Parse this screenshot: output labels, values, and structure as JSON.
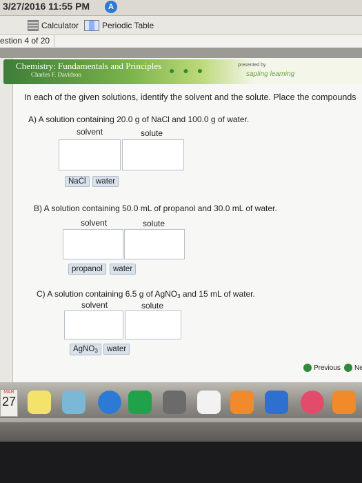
{
  "status": {
    "datetime": "3/27/2016 11:55 PM",
    "badge": "A"
  },
  "tools": {
    "calculator": "Calculator",
    "periodic_table": "Periodic Table"
  },
  "counter": "estion 4 of 20",
  "banner": {
    "title": "Chemistry: Fundamentals and Principles",
    "author": "Charles F. Davidson",
    "presented_by": "presented by",
    "brand": "sapling learning"
  },
  "instructions": "In each of the given solutions, identify the solvent and the solute. Place the compounds",
  "questions": [
    {
      "text": "A) A solution containing 20.0 g of NaCl and 100.0 g of water.",
      "solvent_label": "solvent",
      "solute_label": "solute",
      "chips": [
        "NaCl",
        "water"
      ]
    },
    {
      "text": "B) A solution containing 50.0 mL of propanol and 30.0 mL of water.",
      "solvent_label": "solvent",
      "solute_label": "solute",
      "chips": [
        "propanol",
        "water"
      ]
    },
    {
      "text_pre": "C) A solution containing 6.5 g of AgNO",
      "text_sub": "3",
      "text_post": " and 15 mL of water.",
      "solvent_label": "solvent",
      "solute_label": "solute",
      "chip1_pre": "AgNO",
      "chip1_sub": "3",
      "chip2": "water"
    }
  ],
  "nav": {
    "previous": "Previous",
    "next": "Ne"
  },
  "dock": {
    "date_month": "MAR",
    "date_day": "27"
  },
  "colors": {
    "brand_green": "#2f8a3a",
    "chip_bg": "#d9e1ea"
  }
}
